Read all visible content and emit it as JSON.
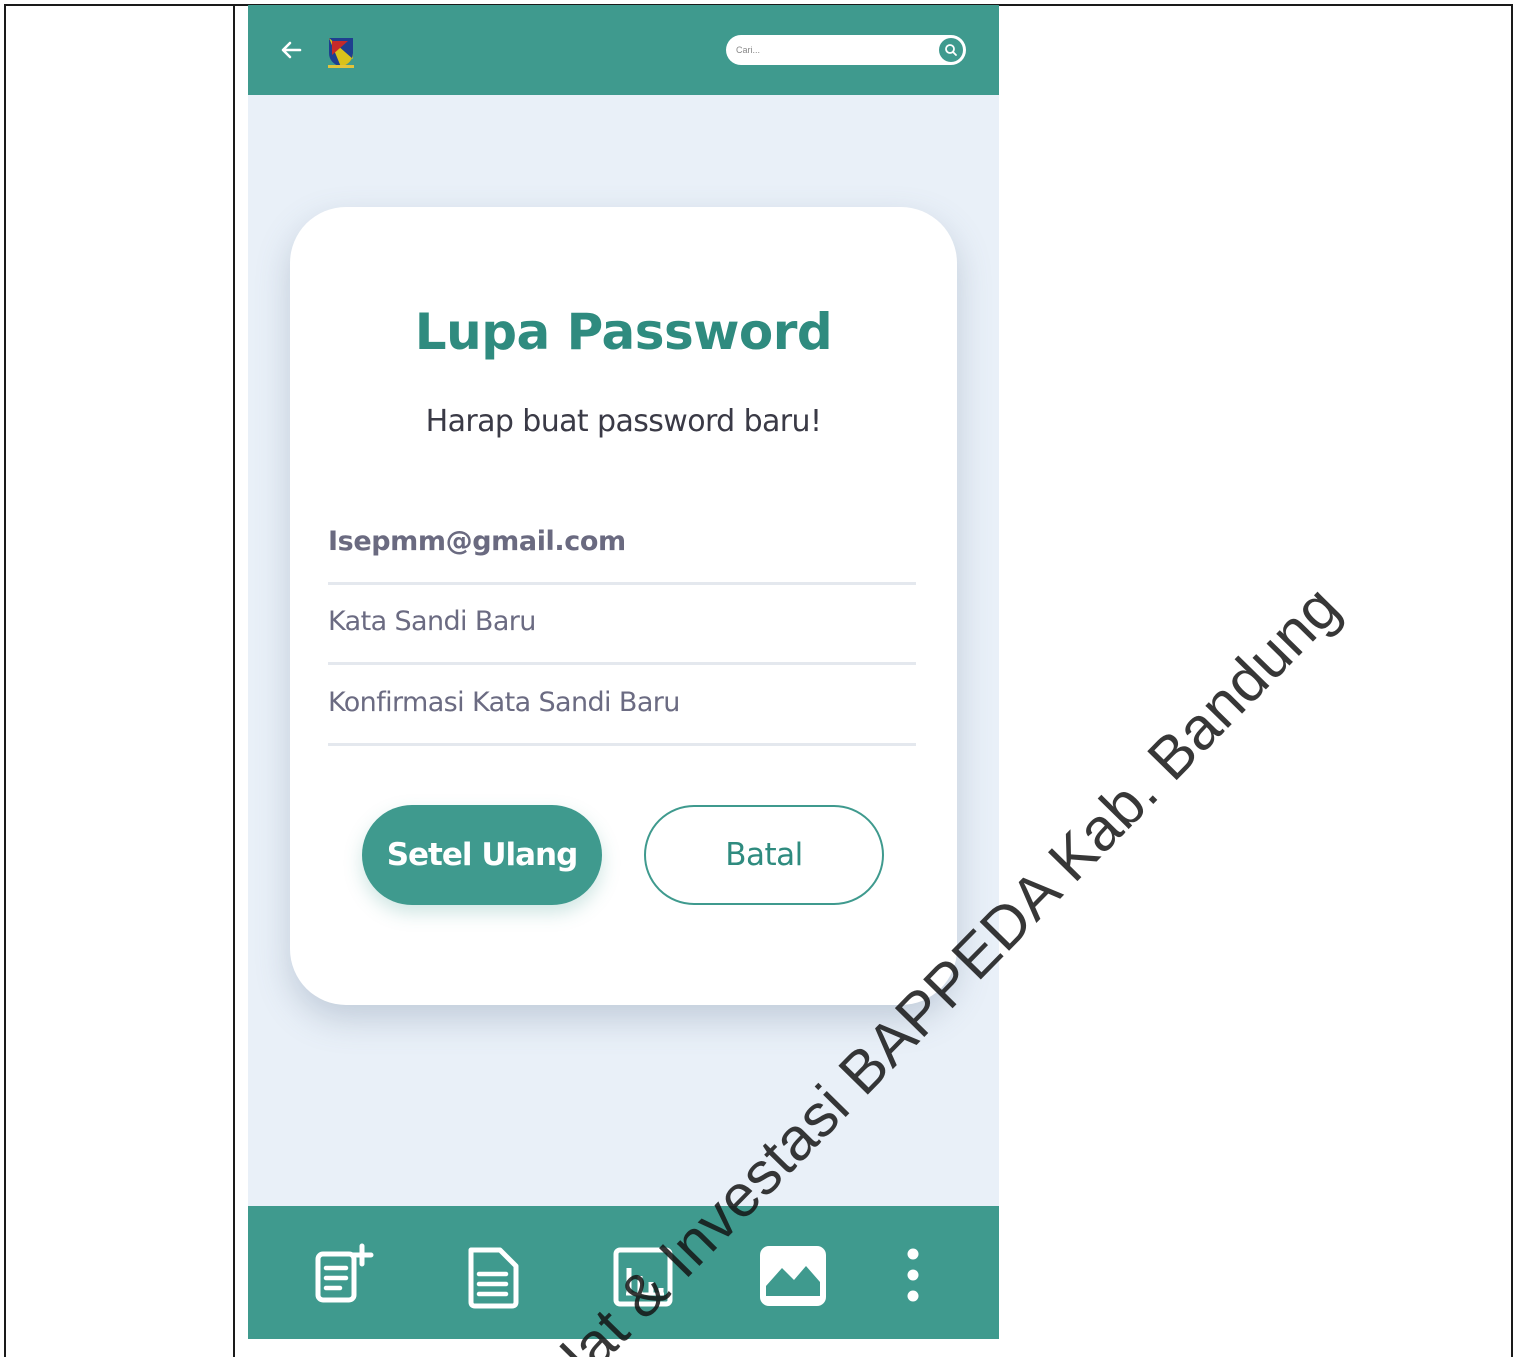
{
  "header": {
    "search_placeholder": "Cari..."
  },
  "card": {
    "title": "Lupa Password",
    "subtitle": "Harap buat password baru!"
  },
  "form": {
    "email_value": "Isepmm@gmail.com",
    "new_password_placeholder": "Kata Sandi Baru",
    "confirm_password_placeholder": "Konfirmasi Kata Sandi Baru"
  },
  "buttons": {
    "reset_label": "Setel Ulang",
    "cancel_label": "Batal"
  },
  "bottom_nav": {
    "items": [
      "add-document-icon",
      "document-icon",
      "chart-icon",
      "image-icon",
      "more-vertical-icon"
    ]
  },
  "watermark": {
    "text": "Alat & Investasi BAPPEDA Kab. Bandung"
  },
  "colors": {
    "accent": "#3f9a8e",
    "page_background": "#e9f0f8",
    "title_text": "#2f8b7f"
  }
}
